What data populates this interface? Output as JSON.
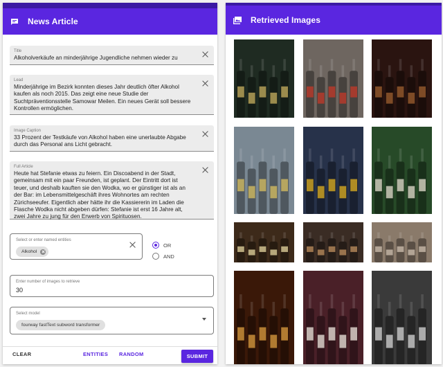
{
  "left": {
    "title": "News Article",
    "fields": {
      "title": {
        "label": "Title",
        "value": "Alkoholverkäufe an minderjährige Jugendliche nehmen wieder zu"
      },
      "lead": {
        "label": "Lead",
        "value": "Minderjährige im Bezirk konnten dieses Jahr deutlich öfter Alkohol kaufen als noch 2015. Das zeigt eine neue Studie der Suchtpräventionsstelle Samowar Meilen. Ein neues Gerät soll bessere Kontrollen ermöglichen."
      },
      "caption": {
        "label": "Image Caption",
        "value": "33 Prozent der Testkäufe von Alkohol haben eine unerlaubte Abgabe durch das Personal ans Licht gebracht."
      },
      "article": {
        "label": "Full Article",
        "value": "Heute hat Stefanie etwas zu feiern. Ein Discoabend in der Stadt, gemeinsam mit ein paar Freunden, ist geplant. Der Eintritt dort ist teuer, und deshalb kauften sie den Wodka, wo er günstiger ist als an der Bar: im Lebensmittelgeschäft ihres Wohnortes am rechten Zürichseeufer. Eigentlich aber hätte ihr die Kassiererin im Laden die Flasche Wodka nicht abgeben dürfen: Stefanie ist erst 16 Jahre alt, zwei Jahre zu jung für den Erwerb von Spirituosen."
      }
    },
    "entities": {
      "label": "Select or enter named entities",
      "chip": "Alkohol"
    },
    "logic": {
      "or": "OR",
      "and": "AND",
      "selected": "OR"
    },
    "count": {
      "label": "Enter number of images to retrieve",
      "value": "30"
    },
    "model": {
      "label": "Select model",
      "chip": "fourway fastText subword transformer"
    },
    "actions": {
      "clear": "CLEAR",
      "entities": "ENTITIES",
      "random": "RANDOM",
      "submit": "SUBMIT"
    }
  },
  "right": {
    "title": "Retrieved Images",
    "images": [
      {
        "name": "retrieved-image-beer-bottle-closeup",
        "bg": "#1f2b22",
        "accent": "#c8b060"
      },
      {
        "name": "retrieved-image-store-shelves",
        "bg": "#6e6660",
        "accent": "#c33a2a"
      },
      {
        "name": "retrieved-image-liquor-wall",
        "bg": "#2a1410",
        "accent": "#a06030"
      },
      {
        "name": "retrieved-image-bottles-on-ice",
        "bg": "#7a8893",
        "accent": "#d8c060"
      },
      {
        "name": "retrieved-image-beer-bottles-table",
        "bg": "#27324a",
        "accent": "#e0b020"
      },
      {
        "name": "retrieved-image-green-bottles",
        "bg": "#274a28",
        "accent": "#e6e0d0"
      },
      {
        "name": "retrieved-image-beer-labels",
        "bg": "#3d2a1a",
        "accent": "#e8d8a0"
      },
      {
        "name": "retrieved-image-bar-shelf",
        "bg": "#3a2c24",
        "accent": "#c09060"
      },
      {
        "name": "retrieved-image-crowd-bar",
        "bg": "#8a7a6a",
        "accent": "#d0c0b0"
      },
      {
        "name": "retrieved-image-pouring-drink",
        "bg": "#3a1808",
        "accent": "#e0a040"
      },
      {
        "name": "retrieved-image-wine-bottles",
        "bg": "#4a2028",
        "accent": "#f0e8e0"
      },
      {
        "name": "retrieved-image-bw-bottles",
        "bg": "#3a3a3a",
        "accent": "#d8d8d8"
      }
    ]
  },
  "colors": {
    "primary": "#5a26e0",
    "primary_dark": "#3b1aa3"
  }
}
